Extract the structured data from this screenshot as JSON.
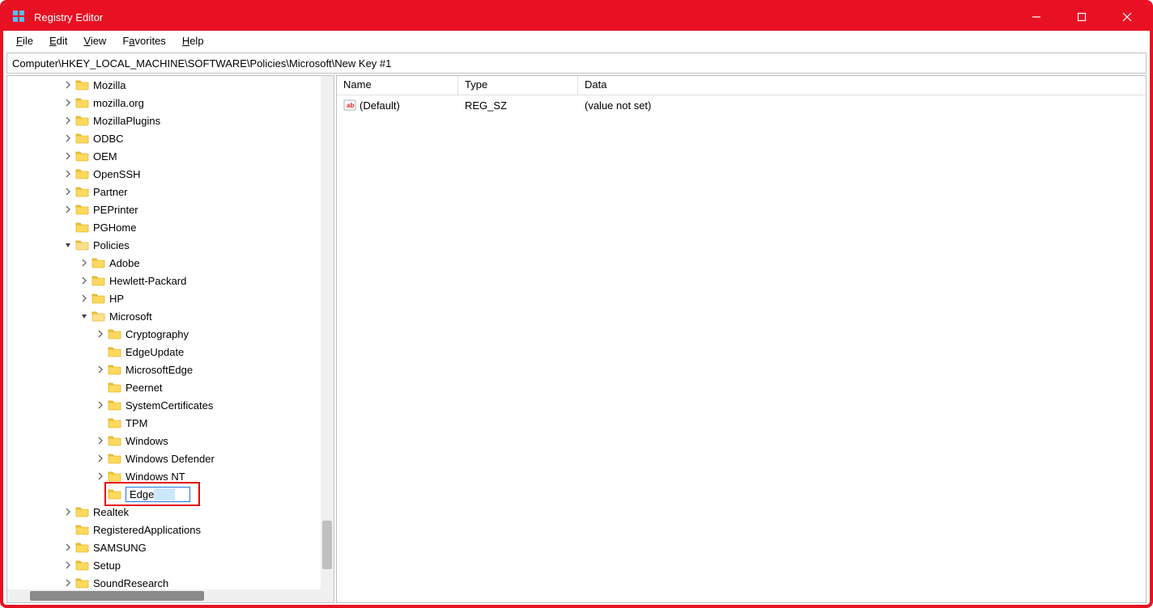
{
  "title": "Registry Editor",
  "menu": {
    "file": "File",
    "edit": "Edit",
    "view": "View",
    "favorites": "Favorites",
    "help": "Help"
  },
  "address": "Computer\\HKEY_LOCAL_MACHINE\\SOFTWARE\\Policies\\Microsoft\\New Key #1",
  "columns": {
    "name": "Name",
    "type": "Type",
    "data": "Data"
  },
  "values": [
    {
      "name": "(Default)",
      "type": "REG_SZ",
      "data": "(value not set)"
    }
  ],
  "tree": {
    "top": [
      {
        "label": "Mozilla",
        "expandable": true
      },
      {
        "label": "mozilla.org",
        "expandable": true
      },
      {
        "label": "MozillaPlugins",
        "expandable": true
      },
      {
        "label": "ODBC",
        "expandable": true
      },
      {
        "label": "OEM",
        "expandable": true
      },
      {
        "label": "OpenSSH",
        "expandable": true
      },
      {
        "label": "Partner",
        "expandable": true
      },
      {
        "label": "PEPrinter",
        "expandable": true
      },
      {
        "label": "PGHome",
        "expandable": false
      }
    ],
    "policies_label": "Policies",
    "policies_children": [
      {
        "label": "Adobe",
        "expandable": true
      },
      {
        "label": "Hewlett-Packard",
        "expandable": true
      },
      {
        "label": "HP",
        "expandable": true
      }
    ],
    "microsoft_label": "Microsoft",
    "microsoft_children": [
      {
        "label": "Cryptography",
        "expandable": true
      },
      {
        "label": "EdgeUpdate",
        "expandable": false
      },
      {
        "label": "MicrosoftEdge",
        "expandable": true
      },
      {
        "label": "Peernet",
        "expandable": false
      },
      {
        "label": "SystemCertificates",
        "expandable": true
      },
      {
        "label": "TPM",
        "expandable": false
      },
      {
        "label": "Windows",
        "expandable": true
      },
      {
        "label": "Windows Defender",
        "expandable": true
      },
      {
        "label": "Windows NT",
        "expandable": true
      }
    ],
    "editing_label": "Edge",
    "bottom": [
      {
        "label": "Realtek",
        "expandable": true
      },
      {
        "label": "RegisteredApplications",
        "expandable": false
      },
      {
        "label": "SAMSUNG",
        "expandable": true
      },
      {
        "label": "Setup",
        "expandable": true
      },
      {
        "label": "SoundResearch",
        "expandable": true
      }
    ]
  }
}
